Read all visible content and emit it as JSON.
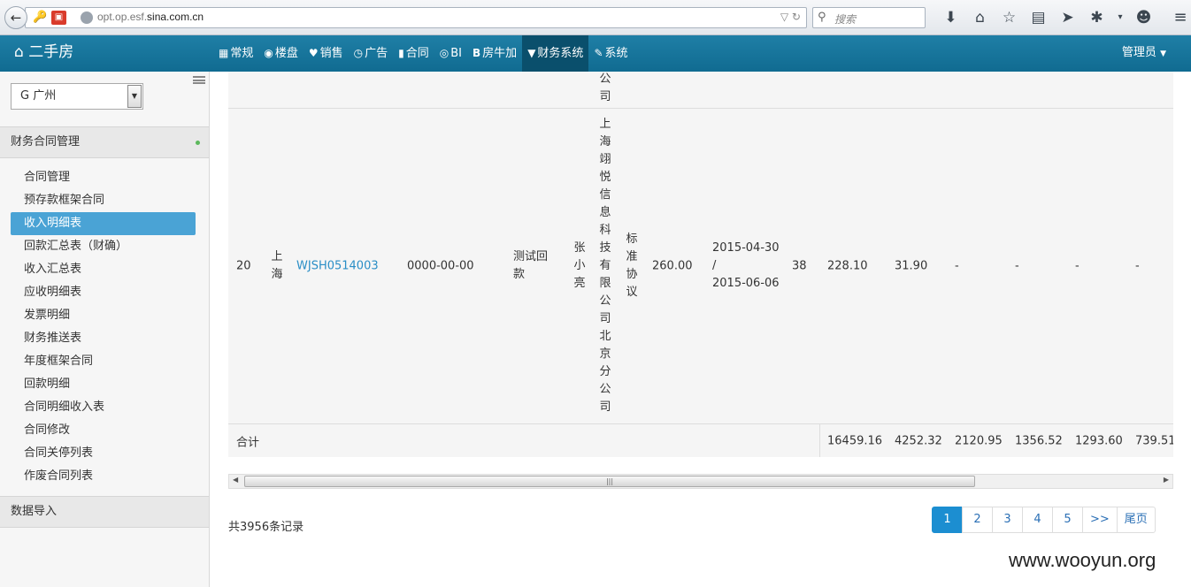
{
  "browser": {
    "url_prefix": "opt.op.esf.",
    "url_domain": "sina.com.cn",
    "search_placeholder": "搜索"
  },
  "navbar": {
    "brand": "二手房",
    "items": [
      {
        "icon": "▦",
        "label": "常规"
      },
      {
        "icon": "◉",
        "label": "楼盘"
      },
      {
        "icon": "♥",
        "label": "销售"
      },
      {
        "icon": "◷",
        "label": "广告"
      },
      {
        "icon": "▮",
        "label": "合同"
      },
      {
        "icon": "◎",
        "label": "BI"
      },
      {
        "icon": "B",
        "label": "房牛加"
      },
      {
        "icon": "▼",
        "label": "财务系统"
      },
      {
        "icon": "✎",
        "label": "系统"
      }
    ],
    "user": "管理员"
  },
  "sidebar": {
    "city": "G 广州",
    "section_title": "财务合同管理",
    "links": [
      "合同管理",
      "预存款框架合同",
      "收入明细表",
      "回款汇总表（财确）",
      "收入汇总表",
      "应收明细表",
      "发票明细",
      "财务推送表",
      "年度框架合同",
      "回款明细",
      "合同明细收入表",
      "合同修改",
      "合同关停列表",
      "作废合同列表"
    ],
    "active_link": "收入明细表",
    "section2_title": "数据导入"
  },
  "table": {
    "prev_row_tail": "公司",
    "row": {
      "index": "20",
      "city": "上海",
      "contract_no": "WJSH0514003",
      "date": "0000-00-00",
      "name": "测试回款",
      "person": "张小亮",
      "company": "上海翊悦信息科技有限公司北京分公司",
      "type": "标准协议",
      "amount": "260.00",
      "period_start": "2015-04-30",
      "period_sep": "/",
      "period_end": "2015-06-06",
      "days": "38",
      "v1": "228.10",
      "v2": "31.90",
      "v3": "-",
      "v4": "-",
      "v5": "-",
      "v6": "-"
    },
    "total": {
      "label": "合计",
      "v1": "16459.16",
      "v2": "4252.32",
      "v3": "2120.95",
      "v4": "1356.52",
      "v5": "1293.60",
      "v6": "739.51"
    }
  },
  "pagination": {
    "records": "共3956条记录",
    "pages": [
      "1",
      "2",
      "3",
      "4",
      "5",
      ">>"
    ],
    "last": "尾页"
  },
  "watermark": "www.wooyun.org"
}
